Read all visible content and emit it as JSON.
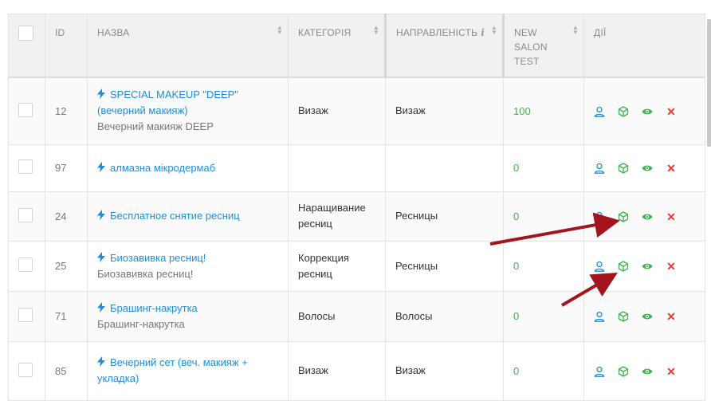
{
  "columns": {
    "id": "ID",
    "name": "НАЗВА",
    "category": "КАТЕГОРІЯ",
    "direction": "НАПРАВЛЕНІСТЬ",
    "test": "NEW SALON TEST",
    "actions": "ДІЇ"
  },
  "rows": [
    {
      "id": "12",
      "name": "SPECIAL MAKEUP \"DEEP\" (вечерний макияж)",
      "sub": "Вечерний макияж DEEP",
      "category": "Визаж",
      "direction": "Визаж",
      "score": "100"
    },
    {
      "id": "97",
      "name": "алмазна мікродермаб",
      "sub": "",
      "category": "",
      "direction": "",
      "score": "0"
    },
    {
      "id": "24",
      "name": "Бесплатное снятие ресниц",
      "sub": "",
      "category": "Наращивание ресниц",
      "direction": "Ресницы",
      "score": "0"
    },
    {
      "id": "25",
      "name": "Биозавивка ресниц!",
      "sub": "Биозавивка ресниц!",
      "category": "Коррекция ресниц",
      "direction": "Ресницы",
      "score": "0"
    },
    {
      "id": "71",
      "name": "Брашинг-накрутка",
      "sub": "Брашинг-накрутка",
      "category": "Волосы",
      "direction": "Волосы",
      "score": "0"
    },
    {
      "id": "85",
      "name": "Вечерний сет (веч. макияж + укладка)",
      "sub": "",
      "category": "Визаж",
      "direction": "Визаж",
      "score": "0"
    }
  ],
  "icons": {
    "user": "user-icon",
    "cube": "cube-icon",
    "eye": "eye-icon",
    "close": "close-icon",
    "bolt": "lightning-icon",
    "info": "info-icon"
  },
  "colors": {
    "link": "#1e8ed8",
    "user_icon": "#1e8ed8",
    "cube_icon": "#3cb54a",
    "eye_icon": "#3cb54a",
    "close_icon": "#e53935",
    "arrow": "#a3141e"
  },
  "close_glyph": "✕"
}
